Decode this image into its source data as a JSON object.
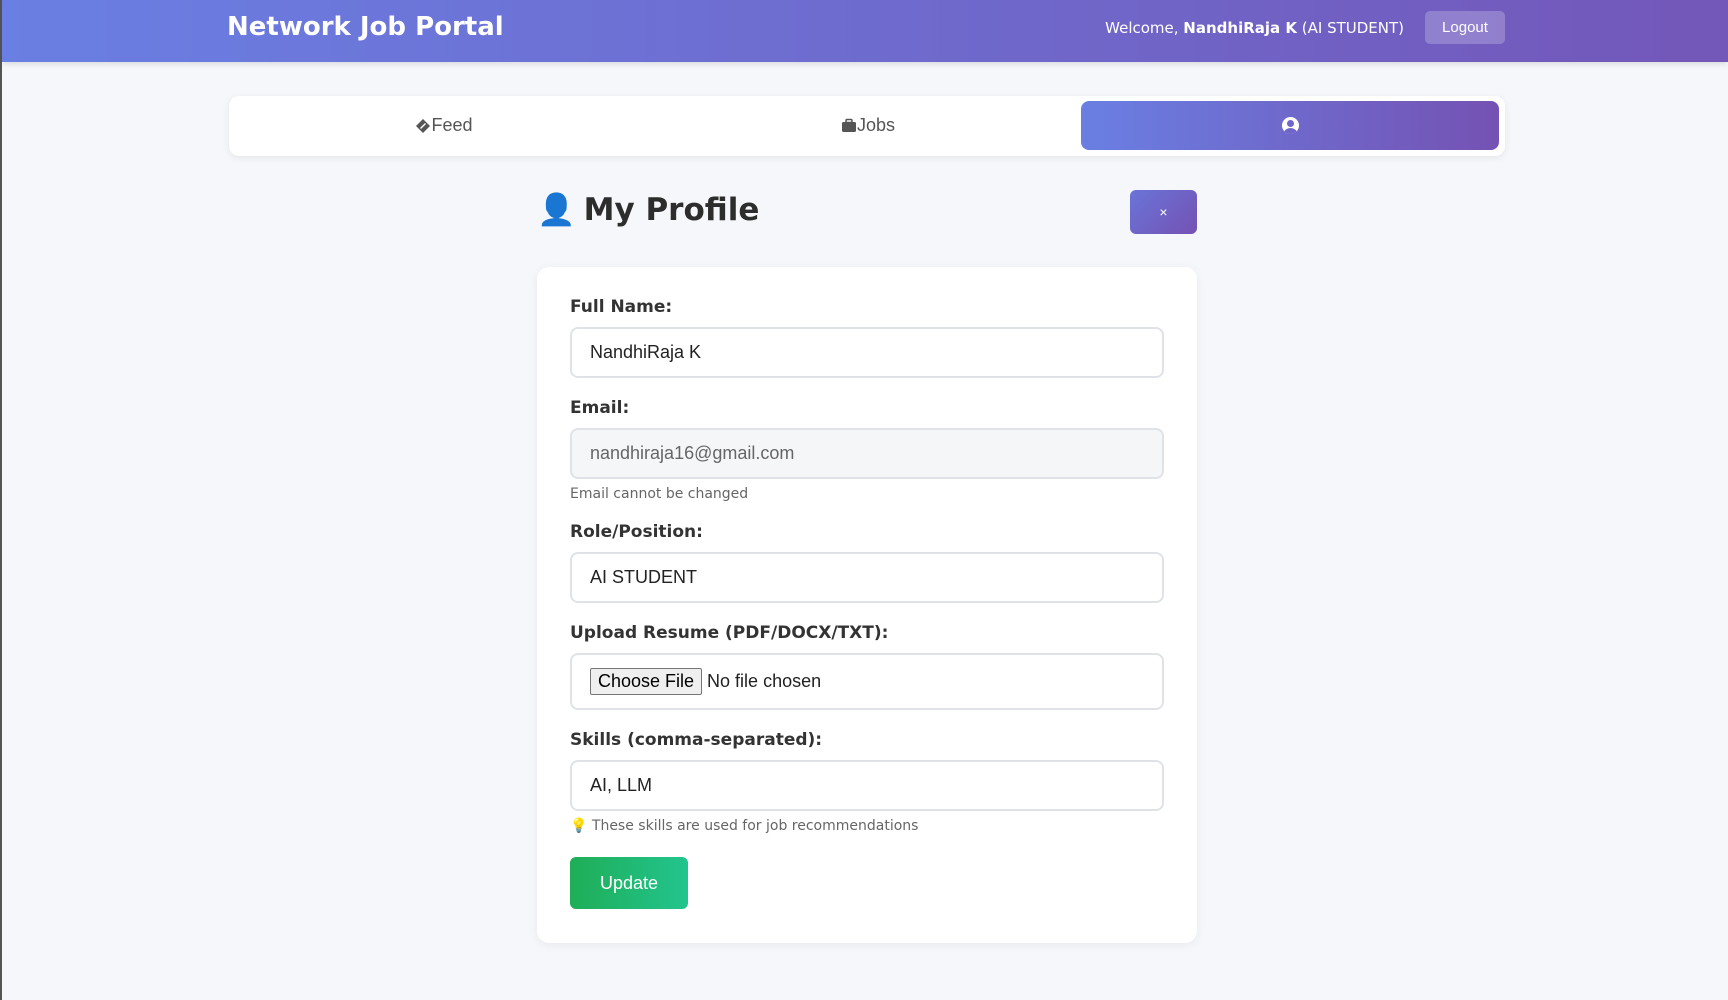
{
  "header": {
    "brand": "Network Job Portal",
    "welcome_prefix": "Welcome, ",
    "user_name": "NandhiRaja K",
    "user_role": " (AI STUDENT)",
    "logout_label": "Logout"
  },
  "tabs": [
    {
      "label": "Feed",
      "icon": "edit-icon"
    },
    {
      "label": "Jobs",
      "icon": "briefcase-icon"
    },
    {
      "label": "",
      "icon": "user-circle-icon",
      "active": true
    }
  ],
  "profile": {
    "title": "My Profile",
    "title_icon": "👤",
    "close_label": "×"
  },
  "form": {
    "full_name_label": "Full Name:",
    "full_name_value": "NandhiRaja K",
    "email_label": "Email:",
    "email_value": "nandhiraja16@gmail.com",
    "email_hint": "Email cannot be changed",
    "role_label": "Role/Position:",
    "role_value": "AI STUDENT",
    "resume_label": "Upload Resume (PDF/DOCX/TXT):",
    "resume_button": "Choose File",
    "resume_status": "No file chosen",
    "skills_label": "Skills (comma-separated):",
    "skills_value": "AI, LLM",
    "skills_hint_icon": "💡",
    "skills_hint": "These skills are used for job recommendations",
    "update_label": "Update"
  },
  "colors": {
    "header_gradient_start": "#6a7fe3",
    "header_gradient_end": "#7357b9",
    "update_green": "#22b868"
  }
}
